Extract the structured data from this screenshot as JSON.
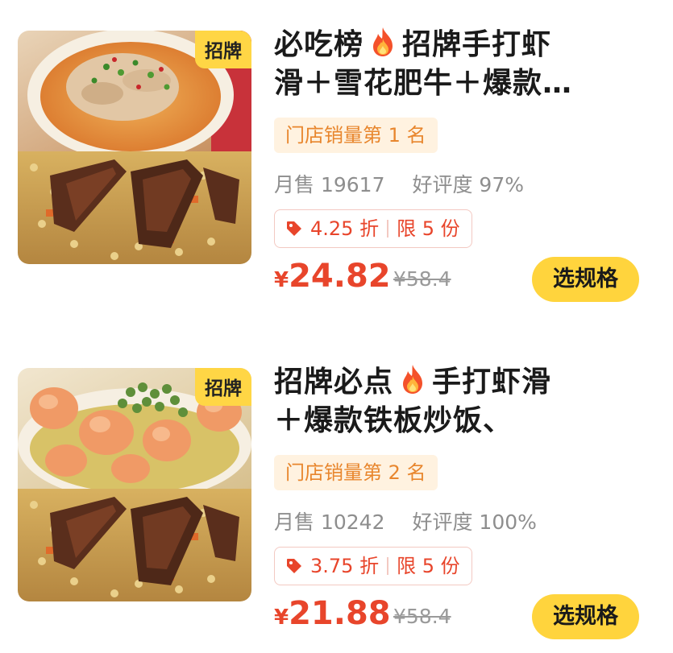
{
  "items": [
    {
      "badge": "招牌",
      "title_line1_pre": "必吃榜",
      "title_line1_post": "招牌手打虾",
      "title_line2": "滑＋雪花肥牛＋爆款…",
      "rank": "门店销量第 1 名",
      "monthly_sales": "月售 19617",
      "rating": "好评度 97%",
      "discount": "4.25 折",
      "limit": "限 5 份",
      "currency": "¥",
      "price": "24.82",
      "original_price": "¥58.4",
      "spec_button": "选规格",
      "top_dish": "shrimp-beef-soup",
      "bottom_dish": "beef-fried-rice"
    },
    {
      "badge": "招牌",
      "title_line1_pre": "招牌必点",
      "title_line1_post": "手打虾滑",
      "title_line2": "＋爆款铁板炒饭、",
      "rank": "门店销量第 2 名",
      "monthly_sales": "月售 10242",
      "rating": "好评度 100%",
      "discount": "3.75 折",
      "limit": "限 5 份",
      "currency": "¥",
      "price": "21.88",
      "original_price": "¥58.4",
      "spec_button": "选规格",
      "top_dish": "shrimp-peas",
      "bottom_dish": "beef-fried-rice"
    }
  ],
  "colors": {
    "accent_yellow": "#ffd43d",
    "price_red": "#e8452b",
    "rank_orange": "#e8862d",
    "rank_bg": "#fff2e0"
  },
  "icons": {
    "title_emoji": "fire-icon",
    "discount_icon": "price-tag-icon"
  }
}
